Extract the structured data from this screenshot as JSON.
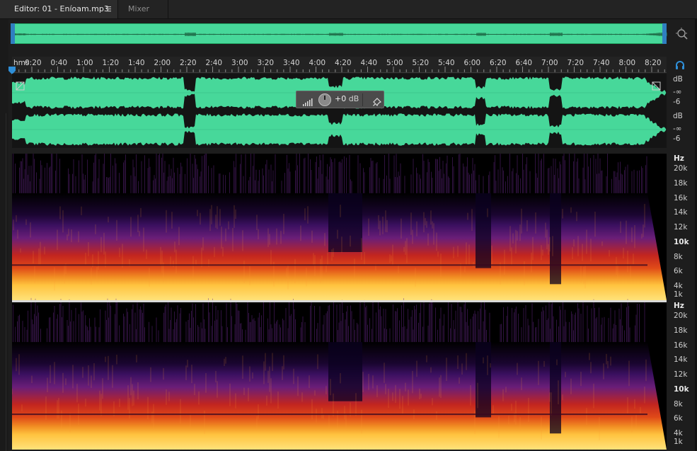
{
  "tabs": {
    "editor": "Editor: 01 - Eníoam.mp3",
    "menu_icon": "hamburger-menu-icon",
    "mixer": "Mixer"
  },
  "ruler": {
    "unit": "hms",
    "labels": [
      "0:20",
      "0:40",
      "1:00",
      "1:20",
      "1:40",
      "2:00",
      "2:20",
      "2:40",
      "3:00",
      "3:20",
      "3:40",
      "4:00",
      "4:20",
      "4:40",
      "5:00",
      "5:20",
      "5:40",
      "6:00",
      "6:20",
      "6:40",
      "7:00",
      "7:20",
      "7:40",
      "8:00",
      "8:20"
    ]
  },
  "amplitude_scale": {
    "top_channel": [
      "dB",
      "-∞",
      "-6"
    ],
    "bottom_channel": [
      "dB",
      "-∞",
      "-6"
    ]
  },
  "hud": {
    "value": "+0",
    "unit": "dB",
    "volume_icon": "volume-bars-icon",
    "knob": "volume-knob",
    "pin_icon": "pin-icon"
  },
  "frequency_scale": {
    "top_channel": [
      "Hz",
      "20k",
      "18k",
      "16k",
      "14k",
      "12k",
      "10k",
      "8k",
      "6k",
      "4k",
      "1k"
    ],
    "bottom_channel": [
      "Hz",
      "20k",
      "18k",
      "16k",
      "14k",
      "12k",
      "10k",
      "8k",
      "6k",
      "4k",
      "1k"
    ]
  },
  "icons": {
    "zoom": "zoom-icon",
    "headphones": "headphones-icon",
    "playhead": "playhead-marker-icon"
  },
  "colors": {
    "waveform": "#47d89a",
    "accent": "#2f8fd8",
    "spectrogram_low": "#ffd34a",
    "spectrogram_mid": "#e23a1f",
    "spectrogram_high": "#5a1a6e"
  }
}
